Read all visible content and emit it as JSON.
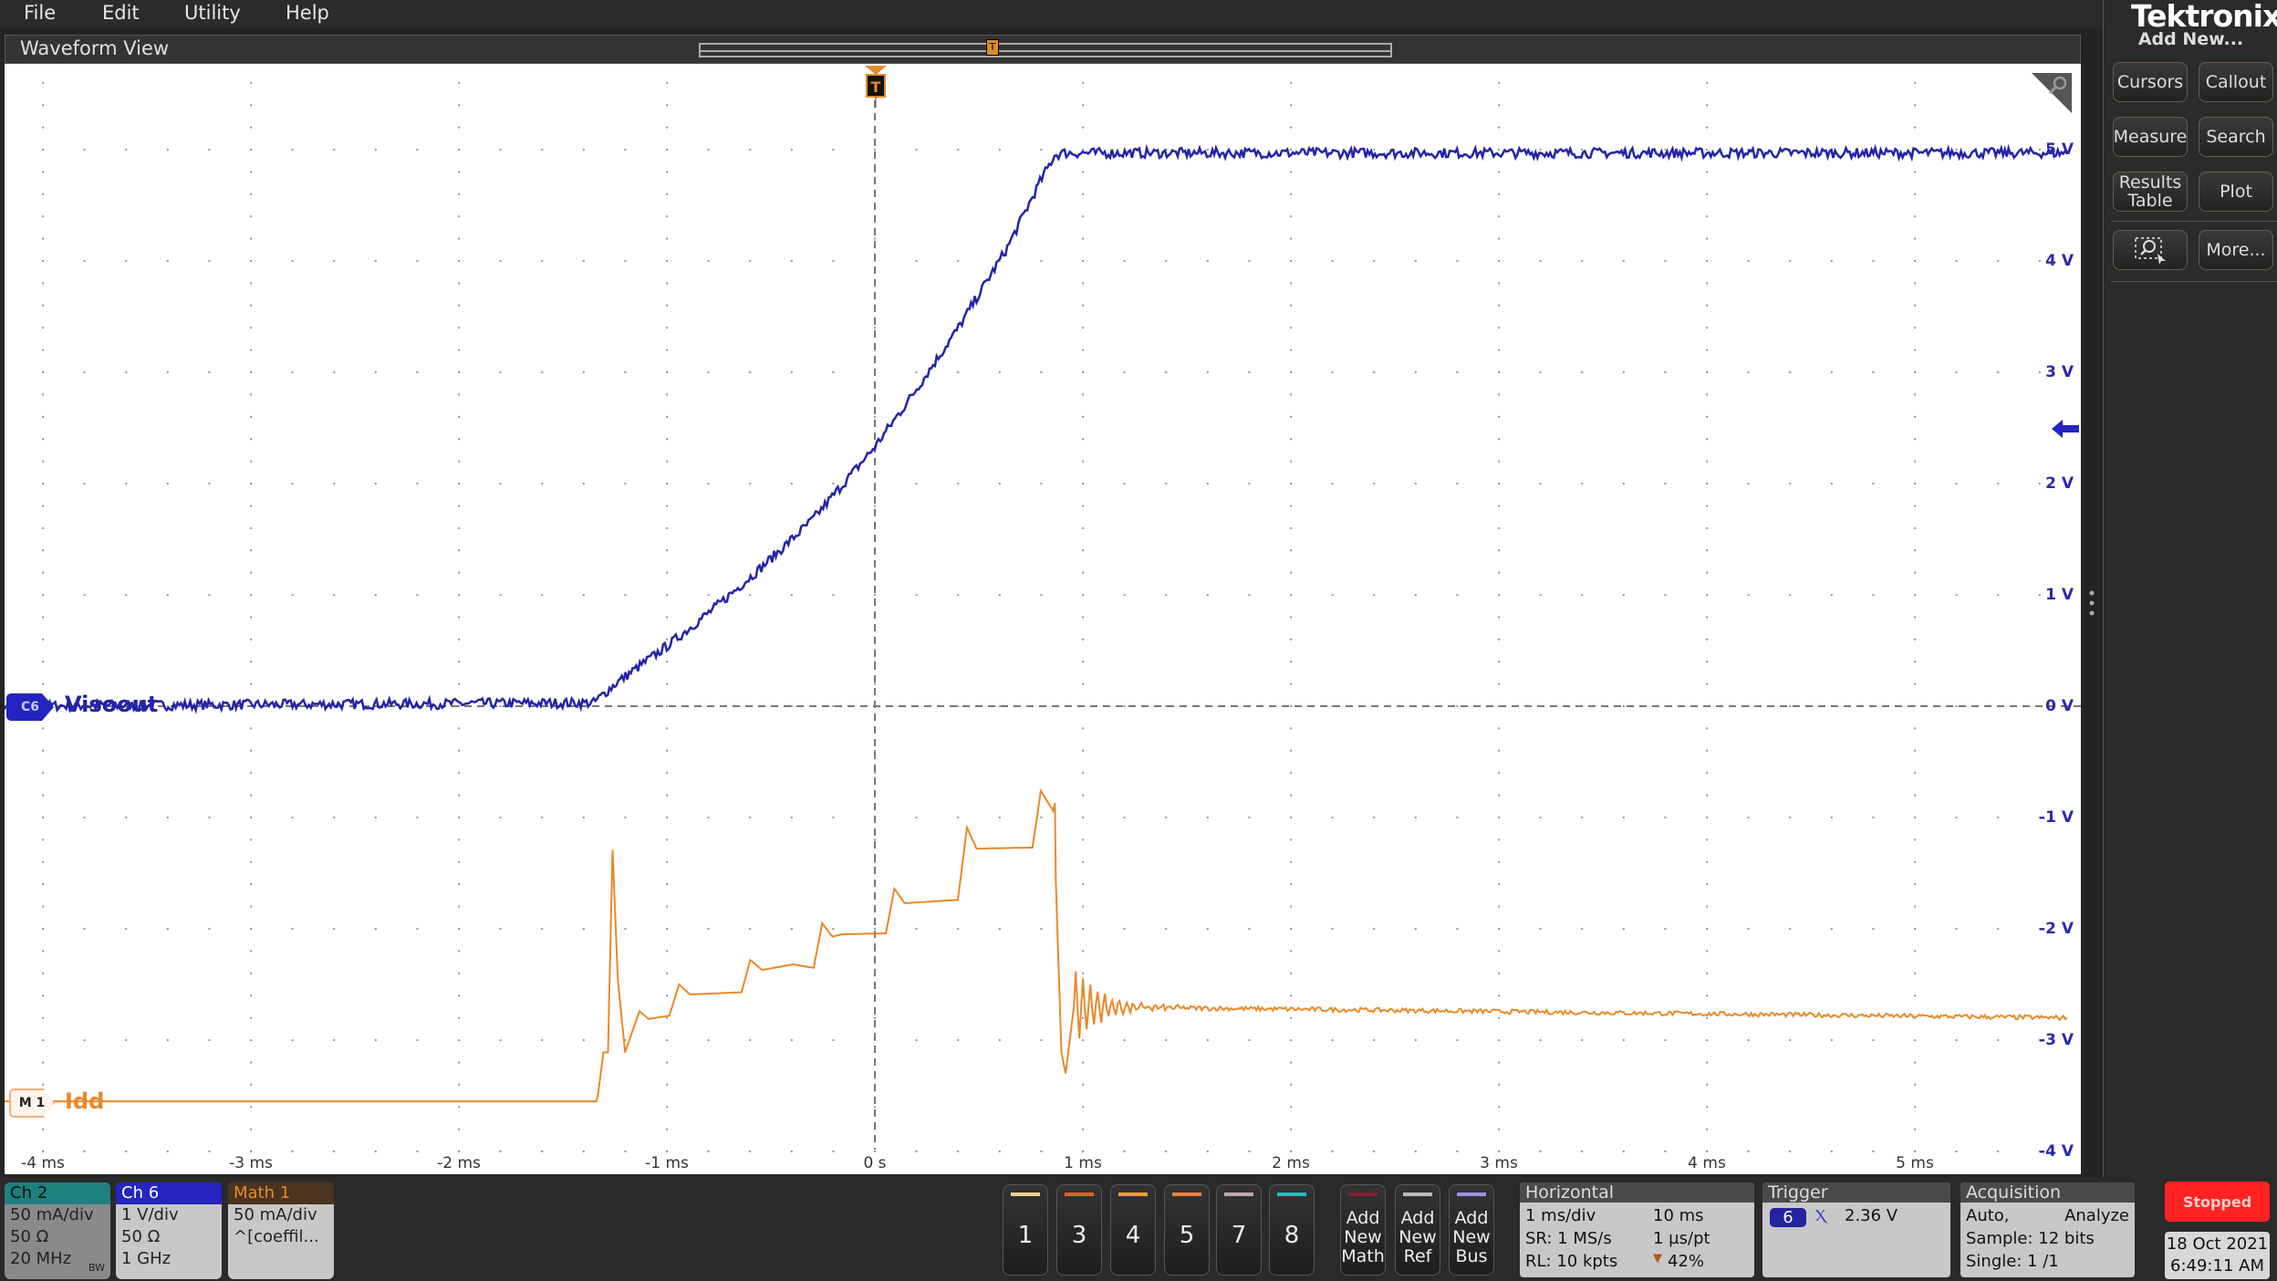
{
  "menu": [
    "File",
    "Edit",
    "Utility",
    "Help"
  ],
  "waveform_view": {
    "title": "Waveform View",
    "trigger_marker": "T"
  },
  "side_panel": {
    "logo": "Tektronix",
    "add_new": "Add New...",
    "buttons": [
      "Cursors",
      "Callout",
      "Measure",
      "Search",
      "Results Table",
      "Plot",
      "zoom-select-icon",
      "More..."
    ]
  },
  "chart_data": {
    "type": "line",
    "xlabel": "",
    "ylabel": "",
    "x_ticks": [
      "-4 ms",
      "-3 ms",
      "-2 ms",
      "-1 ms",
      "0 s",
      "1 ms",
      "2 ms",
      "3 ms",
      "4 ms",
      "5 ms"
    ],
    "y_ticks": [
      "5 V",
      "4 V",
      "3 V",
      "2 V",
      "1 V",
      "0 V",
      "-1 V",
      "-2 V",
      "-3 V",
      "-4 V"
    ],
    "xlim_ms": [
      -4.35,
      5.75
    ],
    "ylim_div": [
      -4.9,
      5.1
    ],
    "grid": true,
    "trigger_time_ms": 0,
    "trigger_level_V": 2.36,
    "series": [
      {
        "name": "Visoout",
        "channel_label": "C6",
        "color": "#2424a8",
        "x_ms": [
          -4.3,
          -1.352,
          -1.242,
          -0.992,
          -0.772,
          -0.537,
          -0.302,
          0,
          0.167,
          0.402,
          0.637,
          0.794,
          0.864,
          0.903,
          5.74
        ],
        "y_div": [
          0,
          0.03,
          0.21,
          0.55,
          0.88,
          1.26,
          1.67,
          2.33,
          2.76,
          3.4,
          4.12,
          4.71,
          4.95,
          4.97,
          4.97
        ]
      },
      {
        "name": "Idd",
        "channel_label": "M 1",
        "color": "#e8892a",
        "x_ms": [
          -4.3,
          -1.34,
          -1.331,
          -1.305,
          -1.283,
          -1.261,
          -1.236,
          -1.201,
          -1.132,
          -1.088,
          -0.988,
          -0.941,
          -0.889,
          -0.641,
          -0.599,
          -0.542,
          -0.395,
          -0.294,
          -0.253,
          -0.204,
          -0.161,
          0.053,
          0.094,
          0.143,
          0.399,
          0.443,
          0.489,
          0.758,
          0.798,
          0.857,
          0.866,
          0.87,
          0.897,
          0.917,
          0.957,
          5.74
        ],
        "y_div": [
          -3.55,
          -3.55,
          -3.49,
          -3.11,
          -3.11,
          -1.29,
          -2.45,
          -3.11,
          -2.74,
          -2.81,
          -2.78,
          -2.5,
          -2.59,
          -2.57,
          -2.28,
          -2.37,
          -2.32,
          -2.35,
          -1.95,
          -2.07,
          -2.05,
          -2.04,
          -1.64,
          -1.77,
          -1.74,
          -1.09,
          -1.28,
          -1.27,
          -0.76,
          -0.94,
          -0.87,
          -1.58,
          -3.11,
          -3.3,
          -2.7,
          -2.8
        ]
      }
    ]
  },
  "channels": [
    {
      "name": "Ch 2",
      "color": "#1f8080",
      "text": "#111",
      "lines": [
        "50 mA/div",
        "50 Ω",
        "20 MHz"
      ],
      "bw": "BW"
    },
    {
      "name": "Ch 6",
      "color": "#2424c0",
      "text": "#fff",
      "lines": [
        "1 V/div",
        "50 Ω",
        "1 GHz"
      ]
    },
    {
      "name": "Math 1",
      "color": "#4a3420",
      "text": "#e8892a",
      "lines": [
        "50 mA/div",
        "^[coeffil..."
      ]
    }
  ],
  "channel_buttons": [
    {
      "label": "1",
      "color": "#f4d08a"
    },
    {
      "label": "3",
      "color": "#e0602a"
    },
    {
      "label": "4",
      "color": "#f0a030"
    },
    {
      "label": "5",
      "color": "#f08040"
    },
    {
      "label": "7",
      "color": "#c0a8b0"
    },
    {
      "label": "8",
      "color": "#20c0c0"
    }
  ],
  "add_buttons": [
    {
      "label": "Add New Math",
      "color": "#802030"
    },
    {
      "label": "Add New Ref",
      "color": "#bbbbbb"
    },
    {
      "label": "Add New Bus",
      "color": "#a090e0"
    }
  ],
  "horizontal": {
    "title": "Horizontal",
    "scale": "1 ms/div",
    "duration": "10 ms",
    "sr": "SR: 1 MS/s",
    "resolution": "1 µs/pt",
    "rl": "RL: 10 kpts",
    "position": "42%"
  },
  "trigger": {
    "title": "Trigger",
    "source": "6",
    "level": "2.36 V"
  },
  "acquisition": {
    "title": "Acquisition",
    "mode": "Auto,",
    "analyze": "Analyze",
    "sample": "Sample: 12 bits",
    "single": "Single: 1 /1"
  },
  "status": {
    "run_state": "Stopped",
    "date": "18 Oct 2021",
    "time": "6:49:11 AM"
  }
}
